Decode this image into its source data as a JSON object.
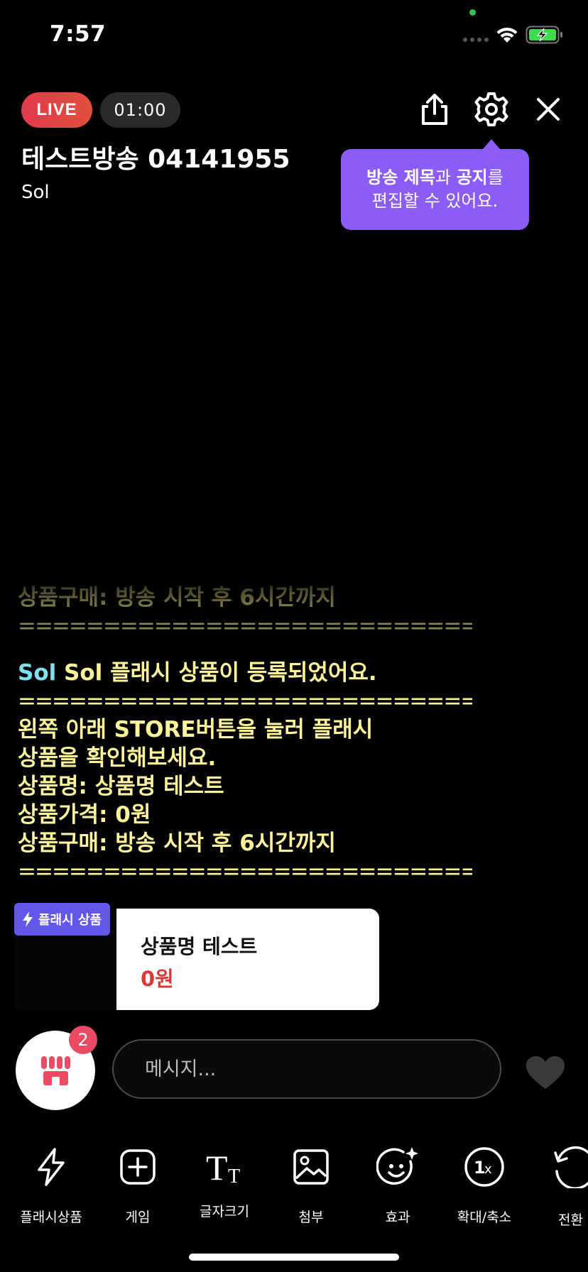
{
  "status_bar": {
    "time": "7:57"
  },
  "header": {
    "live_label": "LIVE",
    "timer": "01:00",
    "title": "테스트방송 04141955",
    "host": "Sol",
    "icons": [
      "share-icon",
      "gear-icon",
      "close-icon"
    ]
  },
  "tooltip": {
    "part1_bold": "방송 제목",
    "part2": "과 ",
    "part3_bold": "공지",
    "part4": "를",
    "line2": "편집할 수 있어요."
  },
  "chat": {
    "faded_line": "상품구매: 방송 시작 후 6시간까지",
    "separator": "==================================",
    "system_user": "Sol",
    "system_text": "Sol 플래시 상품이 등록되었어요.",
    "lines": [
      "왼쪽 아래 STORE버튼을 눌러 플래시",
      "상품을 확인해보세요.",
      "상품명: 상품명 테스트",
      "상품가격: 0원",
      "상품구매: 방송 시작 후 6시간까지"
    ]
  },
  "product": {
    "tag": "플래시 상품",
    "name": "상품명 테스트",
    "price": "0원"
  },
  "input_row": {
    "store_badge_count": "2",
    "message_placeholder": "메시지..."
  },
  "toolbar": {
    "items": [
      {
        "label": "플래시상품",
        "icon": "lightning-icon"
      },
      {
        "label": "게임",
        "icon": "plus-square-icon"
      },
      {
        "label": "글자크기",
        "icon": "text-size-icon"
      },
      {
        "label": "첨부",
        "icon": "image-icon"
      },
      {
        "label": "효과",
        "icon": "smile-sparkle-icon"
      },
      {
        "label": "확대/축소",
        "icon": "zoom-1x-icon"
      },
      {
        "label": "전환",
        "icon": "rotate-camera-icon"
      }
    ]
  },
  "colors": {
    "live_red": "#e23a4d",
    "tooltip_purple": "#8b5cf6",
    "chat_yellow": "#fff39a",
    "chat_user_cyan": "#7fe0f0",
    "flash_tag": "#6257e8",
    "price_red": "#d83a36",
    "badge_pink": "#e84b62"
  }
}
